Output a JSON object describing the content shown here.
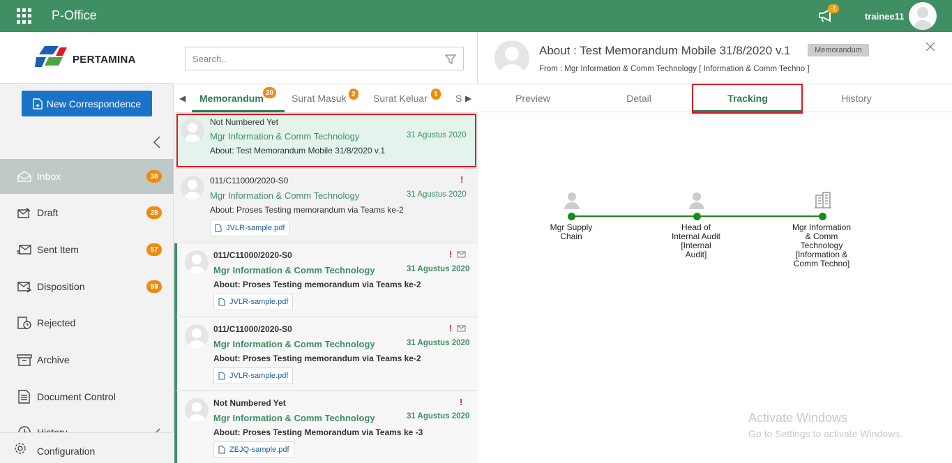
{
  "topbar": {
    "app_title": "P-Office",
    "notif_count": "-1",
    "username": "trainee11"
  },
  "sidebar": {
    "logo_text": "PERTAMINA",
    "new_button": "New Correspondence",
    "items": [
      {
        "label": "Inbox",
        "badge": "38"
      },
      {
        "label": "Draft",
        "badge": "28"
      },
      {
        "label": "Sent Item",
        "badge": "57"
      },
      {
        "label": "Disposition",
        "badge": "59"
      },
      {
        "label": "Rejected"
      },
      {
        "label": "Archive"
      },
      {
        "label": "Document Control"
      },
      {
        "label": "History"
      }
    ],
    "config_label": "Configuration"
  },
  "list": {
    "search_placeholder": "Search..",
    "tabs": [
      {
        "label": "Memorandum",
        "badge": "20"
      },
      {
        "label": "Surat Masuk",
        "badge": "2"
      },
      {
        "label": "Surat Keluar",
        "badge": "1"
      },
      {
        "label": "S"
      }
    ],
    "items": [
      {
        "number": "Not Numbered Yet",
        "from": "Mgr Information & Comm Technology",
        "date": "31 Agustus 2020",
        "about": "About: Test Memorandum Mobile 31/8/2020 v.1"
      },
      {
        "number": "011/C11000/2020-S0",
        "from": "Mgr Information & Comm Technology",
        "date": "31 Agustus 2020",
        "about": "About: Proses Testing memorandum via Teams ke-2",
        "attachment": "JVLR-sample.pdf",
        "excl": "!"
      },
      {
        "number": "011/C11000/2020-S0",
        "from": "Mgr Information & Comm Technology",
        "date": "31 Agustus 2020",
        "about": "About: Proses Testing memorandum via Teams ke-2",
        "attachment": "JVLR-sample.pdf",
        "excl": "!"
      },
      {
        "number": "011/C11000/2020-S0",
        "from": "Mgr Information & Comm Technology",
        "date": "31 Agustus 2020",
        "about": "About: Proses Testing memorandum via Teams ke-2",
        "attachment": "JVLR-sample.pdf",
        "excl": "!"
      },
      {
        "number": "Not Numbered Yet",
        "from": "Mgr Information & Comm Technology",
        "date": "31 Agustus 2020",
        "about": "About: Proses Testing Memorandum via Teams ke -3",
        "attachment": "ZEJQ-sample.pdf",
        "excl": "!"
      }
    ]
  },
  "detail": {
    "title": "About : Test Memorandum Mobile 31/8/2020 v.1",
    "type_pill": "Memorandum",
    "from": "From : Mgr Information & Comm Technology [ Information & Comm Techno ]",
    "tabs": [
      "Preview",
      "Detail",
      "Tracking",
      "History"
    ],
    "tracking": [
      {
        "label_lines": [
          "Mgr Supply",
          "Chain"
        ],
        "icon": "person-icon"
      },
      {
        "label_lines": [
          "Head of",
          "Internal Audit",
          "[Internal",
          "Audit]"
        ],
        "icon": "person-icon"
      },
      {
        "label_lines": [
          "Mgr Information",
          "& Comm",
          "Technology",
          "[Information &",
          "Comm Techno]"
        ],
        "icon": "building-icon"
      }
    ]
  },
  "watermark": {
    "line1": "Activate Windows",
    "line2": "Go to Settings to activate Windows."
  },
  "colors": {
    "brand_green": "#3f8e64",
    "accent_blue": "#1a73c9",
    "badge_orange": "#ee8a0f",
    "highlight_red": "#e0191e"
  }
}
